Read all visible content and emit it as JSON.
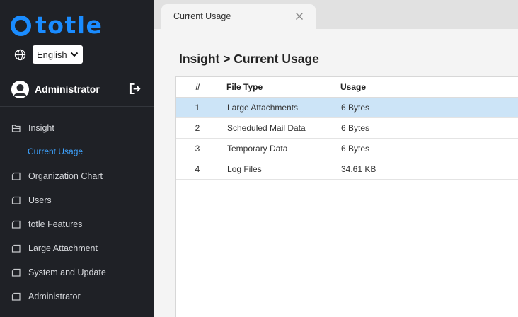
{
  "app": {
    "logo_text": "totle"
  },
  "language": {
    "selected": "English"
  },
  "user": {
    "name": "Administrator"
  },
  "sidebar": {
    "items": [
      {
        "label": "Insight",
        "icon": "folder-open-icon"
      },
      {
        "label": "Organization Chart",
        "icon": "folder-icon"
      },
      {
        "label": "Users",
        "icon": "folder-icon"
      },
      {
        "label": "totle Features",
        "icon": "folder-icon"
      },
      {
        "label": "Large Attachment",
        "icon": "folder-icon"
      },
      {
        "label": "System and Update",
        "icon": "folder-icon"
      },
      {
        "label": "Administrator",
        "icon": "folder-icon"
      }
    ],
    "subitem": {
      "label": "Current Usage",
      "active": true
    }
  },
  "tabs": [
    {
      "label": "Current Usage"
    }
  ],
  "page": {
    "title": "Insight > Current Usage"
  },
  "table": {
    "headers": [
      "#",
      "File Type",
      "Usage"
    ],
    "rows": [
      {
        "num": "1",
        "type": "Large Attachments",
        "usage": "6 Bytes",
        "selected": true
      },
      {
        "num": "2",
        "type": "Scheduled Mail Data",
        "usage": "6 Bytes"
      },
      {
        "num": "3",
        "type": "Temporary Data",
        "usage": "6 Bytes"
      },
      {
        "num": "4",
        "type": "Log Files",
        "usage": "34.61 KB"
      }
    ]
  },
  "colors": {
    "brand": "#1a8cff",
    "sidebar_bg": "#1f2126",
    "active_link": "#3ea3ff",
    "selected_row": "#cce4f7"
  }
}
